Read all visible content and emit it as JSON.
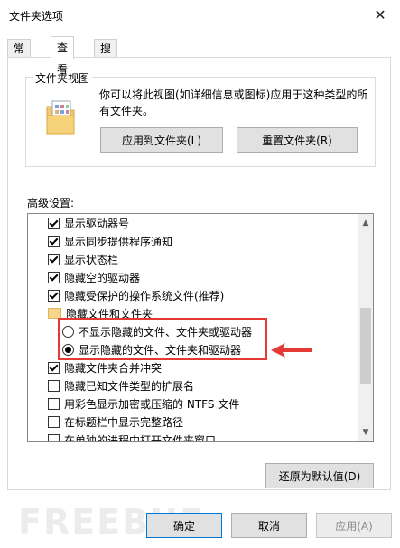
{
  "window": {
    "title": "文件夹选项",
    "close_glyph": "✕"
  },
  "tabs": [
    {
      "label": "常规",
      "active": false
    },
    {
      "label": "查看",
      "active": true
    },
    {
      "label": "搜索",
      "active": false
    }
  ],
  "folder_views": {
    "group_label": "文件夹视图",
    "description": "你可以将此视图(如详细信息或图标)应用于这种类型的所有文件夹。",
    "apply_button": "应用到文件夹(L)",
    "reset_button": "重置文件夹(R)"
  },
  "advanced": {
    "label": "高级设置:",
    "items": [
      {
        "type": "checkbox",
        "checked": true,
        "label": "显示驱动器号"
      },
      {
        "type": "checkbox",
        "checked": true,
        "label": "显示同步提供程序通知"
      },
      {
        "type": "checkbox",
        "checked": true,
        "label": "显示状态栏"
      },
      {
        "type": "checkbox",
        "checked": true,
        "label": "隐藏空的驱动器"
      },
      {
        "type": "checkbox",
        "checked": true,
        "label": "隐藏受保护的操作系统文件(推荐)"
      },
      {
        "type": "folder",
        "label": "隐藏文件和文件夹"
      },
      {
        "type": "radio",
        "checked": false,
        "label": "不显示隐藏的文件、文件夹或驱动器"
      },
      {
        "type": "radio",
        "checked": true,
        "label": "显示隐藏的文件、文件夹和驱动器"
      },
      {
        "type": "checkbox",
        "checked": true,
        "label": "隐藏文件夹合并冲突"
      },
      {
        "type": "checkbox",
        "checked": false,
        "label": "隐藏已知文件类型的扩展名"
      },
      {
        "type": "checkbox",
        "checked": false,
        "label": "用彩色显示加密或压缩的 NTFS 文件"
      },
      {
        "type": "checkbox",
        "checked": false,
        "label": "在标题栏中显示完整路径"
      },
      {
        "type": "checkbox",
        "checked": false,
        "label": "在单独的进程中打开文件夹窗口"
      }
    ],
    "restore_defaults": "还原为默认值(D)"
  },
  "footer": {
    "ok": "确定",
    "cancel": "取消",
    "apply": "应用(A)"
  },
  "watermark": "FREEBUF",
  "colors": {
    "highlight": "#e53935",
    "accent": "#0078d7"
  }
}
